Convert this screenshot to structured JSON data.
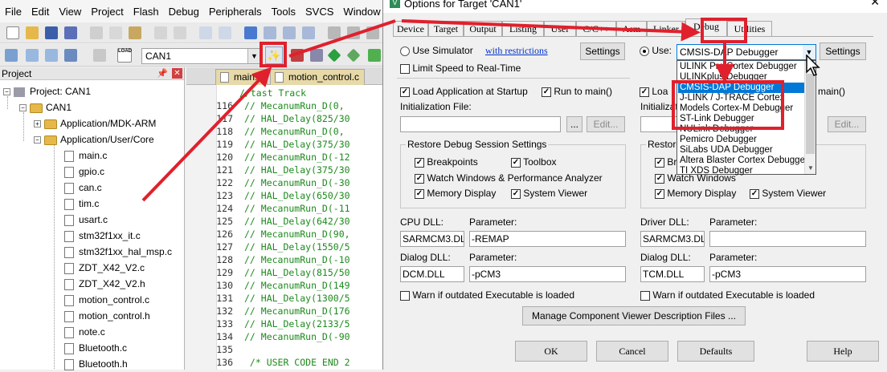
{
  "ide": {
    "menu": [
      "File",
      "Edit",
      "View",
      "Project",
      "Flash",
      "Debug",
      "Peripherals",
      "Tools",
      "SVCS",
      "Window",
      "H"
    ],
    "target_name": "CAN1",
    "load_label": "LOAD",
    "project_panel_title": "Project",
    "tree": {
      "project": "Project: CAN1",
      "target": "CAN1",
      "folders": [
        "Application/MDK-ARM",
        "Application/User/Core"
      ],
      "files": [
        "main.c",
        "gpio.c",
        "can.c",
        "tim.c",
        "usart.c",
        "stm32f1xx_it.c",
        "stm32f1xx_hal_msp.c",
        "ZDT_X42_V2.c",
        "ZDT_X42_V2.h",
        "motion_control.c",
        "motion_control.h",
        "note.c",
        "Bluetooth.c",
        "Bluetooth.h"
      ]
    },
    "editor_tabs": [
      "main.c",
      "motion_control.c"
    ],
    "code": [
      {
        "ln": "",
        "text": "//tast Track"
      },
      {
        "ln": "116",
        "text": "//  MecanumRun_D(0,"
      },
      {
        "ln": "117",
        "text": "//  HAL_Delay(825/30"
      },
      {
        "ln": "118",
        "text": "//  MecanumRun_D(0,"
      },
      {
        "ln": "119",
        "text": "//  HAL_Delay(375/30"
      },
      {
        "ln": "120",
        "text": "//  MecanumRun_D(-12"
      },
      {
        "ln": "121",
        "text": "//  HAL_Delay(375/30"
      },
      {
        "ln": "122",
        "text": "//  MecanumRun_D(-30"
      },
      {
        "ln": "123",
        "text": "//  HAL_Delay(650/30"
      },
      {
        "ln": "124",
        "text": "//  MecanumRun_D(-11"
      },
      {
        "ln": "125",
        "text": "//  HAL_Delay(642/30"
      },
      {
        "ln": "126",
        "text": "//  MecanumRun_D(90,"
      },
      {
        "ln": "127",
        "text": "//  HAL_Delay(1550/5"
      },
      {
        "ln": "128",
        "text": "//  MecanumRun_D(-10"
      },
      {
        "ln": "129",
        "text": "//  HAL_Delay(815/50"
      },
      {
        "ln": "130",
        "text": "//  MecanumRun_D(149"
      },
      {
        "ln": "131",
        "text": "//  HAL_Delay(1300/5"
      },
      {
        "ln": "132",
        "text": "//  MecanumRun_D(176"
      },
      {
        "ln": "133",
        "text": "//  HAL_Delay(2133/5"
      },
      {
        "ln": "134",
        "text": "//  MecanumRun_D(-90"
      },
      {
        "ln": "135",
        "text": ""
      },
      {
        "ln": "136",
        "text": "  /* USER CODE END 2"
      }
    ]
  },
  "dialog": {
    "title": "Options for Target 'CAN1'",
    "close": "✕",
    "tabs": [
      "Device",
      "Target",
      "Output",
      "Listing",
      "User",
      "C/C++",
      "Asm",
      "Linker",
      "Debug",
      "Utilities"
    ],
    "active_tab": "Debug",
    "left": {
      "use_simulator": "Use Simulator",
      "restrictions_link": "with restrictions",
      "settings": "Settings",
      "limit_speed": "Limit Speed to Real-Time",
      "load_app": "Load Application at Startup",
      "run_main": "Run to main()",
      "init_file_label": "Initialization File:",
      "browse": "...",
      "edit": "Edit...",
      "restore_group": "Restore Debug Session Settings",
      "breakpoints": "Breakpoints",
      "toolbox": "Toolbox",
      "watch": "Watch Windows & Performance Analyzer",
      "memory": "Memory Display",
      "sysviewer": "System Viewer",
      "cpu_dll_label": "CPU DLL:",
      "cpu_param_label": "Parameter:",
      "cpu_dll": "SARMCM3.DLL",
      "cpu_param": "-REMAP",
      "dialog_dll_label": "Dialog DLL:",
      "dialog_param_label": "Parameter:",
      "dialog_dll": "DCM.DLL",
      "dialog_param": "-pCM3",
      "warn": "Warn if outdated Executable is loaded"
    },
    "right": {
      "use": "Use:",
      "selected_debugger": "CMSIS-DAP Debugger",
      "settings": "Settings",
      "load_app_part": "Loa",
      "run_main_part": "main()",
      "init_part": "Initializatio",
      "edit": "Edit...",
      "restore_part": "Restore",
      "brk_part": "Bre",
      "watch_part": "Watch Windows",
      "memory": "Memory Display",
      "sysviewer": "System Viewer",
      "driver_dll_label": "Driver DLL:",
      "driver_param_label": "Parameter:",
      "driver_dll": "SARMCM3.DLL",
      "driver_param": "",
      "dialog_dll_label": "Dialog DLL:",
      "dialog_param_label": "Parameter:",
      "dialog_dll": "TCM.DLL",
      "dialog_param": "-pCM3",
      "warn": "Warn if outdated Executable is loaded"
    },
    "debugger_list": [
      "ULINK Pro Cortex Debugger",
      "ULINKplus Debugger",
      "CMSIS-DAP Debugger",
      "J-LINK / J-TRACE Cortex",
      "Models Cortex-M Debugger",
      "ST-Link Debugger",
      "NULink Debugger",
      "Pemicro Debugger",
      "SiLabs UDA Debugger",
      "Altera Blaster Cortex Debugger",
      "TI XDS Debugger"
    ],
    "manage_btn": "Manage Component Viewer Description Files ...",
    "buttons": {
      "ok": "OK",
      "cancel": "Cancel",
      "defaults": "Defaults",
      "help": "Help"
    }
  },
  "colors": {
    "annotation_red": "#e0202c",
    "selection_blue": "#0078d7",
    "comment_green": "#1c8a1c"
  }
}
